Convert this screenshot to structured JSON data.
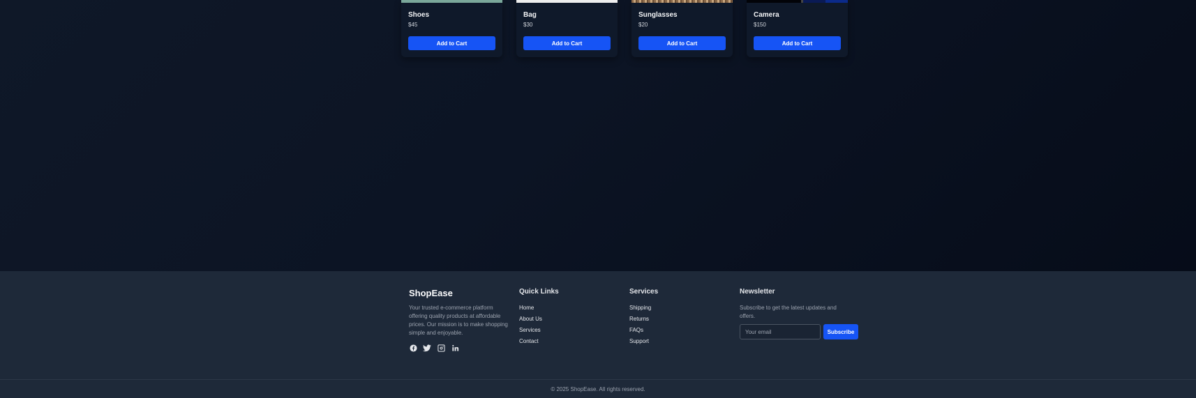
{
  "products": [
    {
      "name": "Shoes",
      "price": "$45",
      "button": "Add to Cart"
    },
    {
      "name": "Bag",
      "price": "$30",
      "button": "Add to Cart"
    },
    {
      "name": "Sunglasses",
      "price": "$20",
      "button": "Add to Cart"
    },
    {
      "name": "Camera",
      "price": "$150",
      "button": "Add to Cart"
    }
  ],
  "footer": {
    "brand": "ShopEase",
    "about": "Your trusted e-commerce platform offering quality products at affordable prices. Our mission is to make shopping simple and enjoyable.",
    "social_icons": [
      "facebook-icon",
      "twitter-icon",
      "instagram-icon",
      "linkedin-icon"
    ],
    "quick_links": {
      "title": "Quick Links",
      "items": [
        "Home",
        "About Us",
        "Services",
        "Contact"
      ]
    },
    "services": {
      "title": "Services",
      "items": [
        "Shipping",
        "Returns",
        "FAQs",
        "Support"
      ]
    },
    "newsletter": {
      "title": "Newsletter",
      "text": "Subscribe to get the latest updates and offers.",
      "email_placeholder": "Your email",
      "email_value": "",
      "button": "Subscribe"
    },
    "copyright": "© 2025 ShopEase. All rights reserved."
  },
  "colors": {
    "accent": "#1654f5",
    "footer_bg": "#1e2939",
    "page_bg": "#0b1220"
  }
}
